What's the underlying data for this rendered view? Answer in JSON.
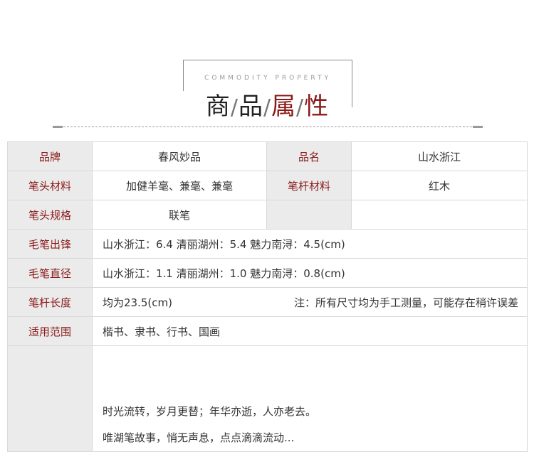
{
  "header": {
    "subtitle": "COMMODITY PROPERTY",
    "title_chars": [
      "商",
      "品",
      "属",
      "性"
    ],
    "title_separator": "/",
    "accent_color": "#8b1a1a"
  },
  "table": {
    "rows": [
      {
        "label": "品牌",
        "value": "春风妙品",
        "label2": "品名",
        "value2": "山水浙江"
      },
      {
        "label": "笔头材料",
        "value": "加健羊毫、兼毫、兼毫",
        "label2": "笔杆材料",
        "value2": "红木"
      },
      {
        "label": "笔头规格",
        "value": "联笔",
        "label2": "",
        "value2": ""
      },
      {
        "label": "毛笔出锋",
        "value": "山水浙江：6.4  清丽湖州：5.4  魅力南浔：4.5(cm)"
      },
      {
        "label": "毛笔直径",
        "value": "山水浙江：1.1  清丽湖州：1.0  魅力南浔：0.8(cm)"
      },
      {
        "label": "笔杆长度",
        "value": "均为23.5(cm)",
        "note": "注：所有尺寸均为手工测量，可能存在稍许误差"
      },
      {
        "label": "适用范围",
        "value": "楷书、隶书、行书、国画"
      }
    ],
    "story_lines": [
      "时光流转，岁月更替；年华亦逝，人亦老去。",
      "唯湖笔故事，悄无声息，点点滴滴流动..."
    ]
  }
}
